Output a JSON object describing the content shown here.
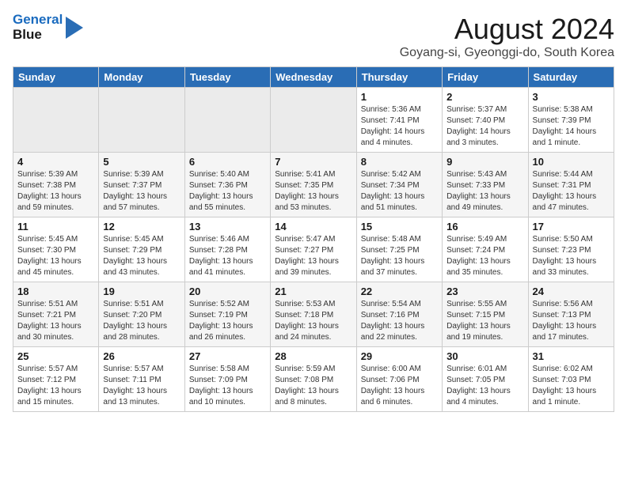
{
  "header": {
    "logo_line1": "General",
    "logo_line2": "Blue",
    "month": "August 2024",
    "location": "Goyang-si, Gyeonggi-do, South Korea"
  },
  "weekdays": [
    "Sunday",
    "Monday",
    "Tuesday",
    "Wednesday",
    "Thursday",
    "Friday",
    "Saturday"
  ],
  "weeks": [
    [
      {
        "day": "",
        "info": ""
      },
      {
        "day": "",
        "info": ""
      },
      {
        "day": "",
        "info": ""
      },
      {
        "day": "",
        "info": ""
      },
      {
        "day": "1",
        "info": "Sunrise: 5:36 AM\nSunset: 7:41 PM\nDaylight: 14 hours\nand 4 minutes."
      },
      {
        "day": "2",
        "info": "Sunrise: 5:37 AM\nSunset: 7:40 PM\nDaylight: 14 hours\nand 3 minutes."
      },
      {
        "day": "3",
        "info": "Sunrise: 5:38 AM\nSunset: 7:39 PM\nDaylight: 14 hours\nand 1 minute."
      }
    ],
    [
      {
        "day": "4",
        "info": "Sunrise: 5:39 AM\nSunset: 7:38 PM\nDaylight: 13 hours\nand 59 minutes."
      },
      {
        "day": "5",
        "info": "Sunrise: 5:39 AM\nSunset: 7:37 PM\nDaylight: 13 hours\nand 57 minutes."
      },
      {
        "day": "6",
        "info": "Sunrise: 5:40 AM\nSunset: 7:36 PM\nDaylight: 13 hours\nand 55 minutes."
      },
      {
        "day": "7",
        "info": "Sunrise: 5:41 AM\nSunset: 7:35 PM\nDaylight: 13 hours\nand 53 minutes."
      },
      {
        "day": "8",
        "info": "Sunrise: 5:42 AM\nSunset: 7:34 PM\nDaylight: 13 hours\nand 51 minutes."
      },
      {
        "day": "9",
        "info": "Sunrise: 5:43 AM\nSunset: 7:33 PM\nDaylight: 13 hours\nand 49 minutes."
      },
      {
        "day": "10",
        "info": "Sunrise: 5:44 AM\nSunset: 7:31 PM\nDaylight: 13 hours\nand 47 minutes."
      }
    ],
    [
      {
        "day": "11",
        "info": "Sunrise: 5:45 AM\nSunset: 7:30 PM\nDaylight: 13 hours\nand 45 minutes."
      },
      {
        "day": "12",
        "info": "Sunrise: 5:45 AM\nSunset: 7:29 PM\nDaylight: 13 hours\nand 43 minutes."
      },
      {
        "day": "13",
        "info": "Sunrise: 5:46 AM\nSunset: 7:28 PM\nDaylight: 13 hours\nand 41 minutes."
      },
      {
        "day": "14",
        "info": "Sunrise: 5:47 AM\nSunset: 7:27 PM\nDaylight: 13 hours\nand 39 minutes."
      },
      {
        "day": "15",
        "info": "Sunrise: 5:48 AM\nSunset: 7:25 PM\nDaylight: 13 hours\nand 37 minutes."
      },
      {
        "day": "16",
        "info": "Sunrise: 5:49 AM\nSunset: 7:24 PM\nDaylight: 13 hours\nand 35 minutes."
      },
      {
        "day": "17",
        "info": "Sunrise: 5:50 AM\nSunset: 7:23 PM\nDaylight: 13 hours\nand 33 minutes."
      }
    ],
    [
      {
        "day": "18",
        "info": "Sunrise: 5:51 AM\nSunset: 7:21 PM\nDaylight: 13 hours\nand 30 minutes."
      },
      {
        "day": "19",
        "info": "Sunrise: 5:51 AM\nSunset: 7:20 PM\nDaylight: 13 hours\nand 28 minutes."
      },
      {
        "day": "20",
        "info": "Sunrise: 5:52 AM\nSunset: 7:19 PM\nDaylight: 13 hours\nand 26 minutes."
      },
      {
        "day": "21",
        "info": "Sunrise: 5:53 AM\nSunset: 7:18 PM\nDaylight: 13 hours\nand 24 minutes."
      },
      {
        "day": "22",
        "info": "Sunrise: 5:54 AM\nSunset: 7:16 PM\nDaylight: 13 hours\nand 22 minutes."
      },
      {
        "day": "23",
        "info": "Sunrise: 5:55 AM\nSunset: 7:15 PM\nDaylight: 13 hours\nand 19 minutes."
      },
      {
        "day": "24",
        "info": "Sunrise: 5:56 AM\nSunset: 7:13 PM\nDaylight: 13 hours\nand 17 minutes."
      }
    ],
    [
      {
        "day": "25",
        "info": "Sunrise: 5:57 AM\nSunset: 7:12 PM\nDaylight: 13 hours\nand 15 minutes."
      },
      {
        "day": "26",
        "info": "Sunrise: 5:57 AM\nSunset: 7:11 PM\nDaylight: 13 hours\nand 13 minutes."
      },
      {
        "day": "27",
        "info": "Sunrise: 5:58 AM\nSunset: 7:09 PM\nDaylight: 13 hours\nand 10 minutes."
      },
      {
        "day": "28",
        "info": "Sunrise: 5:59 AM\nSunset: 7:08 PM\nDaylight: 13 hours\nand 8 minutes."
      },
      {
        "day": "29",
        "info": "Sunrise: 6:00 AM\nSunset: 7:06 PM\nDaylight: 13 hours\nand 6 minutes."
      },
      {
        "day": "30",
        "info": "Sunrise: 6:01 AM\nSunset: 7:05 PM\nDaylight: 13 hours\nand 4 minutes."
      },
      {
        "day": "31",
        "info": "Sunrise: 6:02 AM\nSunset: 7:03 PM\nDaylight: 13 hours\nand 1 minute."
      }
    ]
  ]
}
